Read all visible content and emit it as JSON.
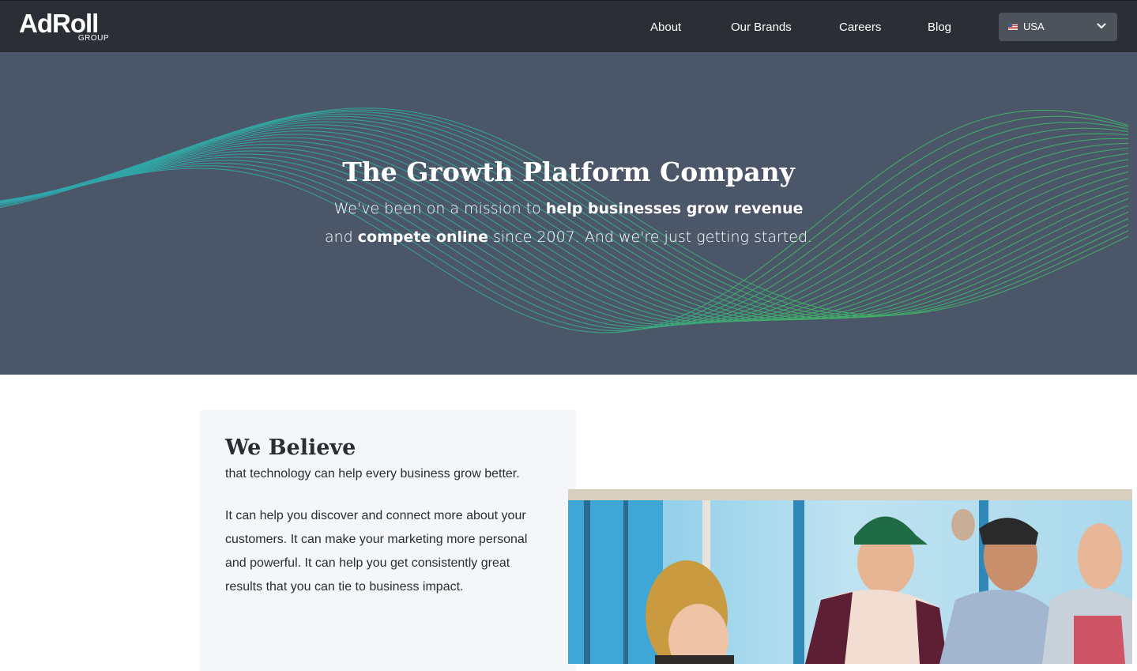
{
  "nav": {
    "logo_main": "AdRoll",
    "logo_sub": "GROUP",
    "links": [
      "About",
      "Our Brands",
      "Careers",
      "Blog"
    ],
    "country": {
      "selected": "USA",
      "flag_icon": "us-flag-icon"
    }
  },
  "hero": {
    "title": "The Growth Platform Company",
    "line1_pre": "We've been on a mission to ",
    "line1_bold": "help businesses grow revenue",
    "line2_pre": "and ",
    "line2_bold": "compete online",
    "line2_post": " since 2007. And we're just getting started."
  },
  "believe": {
    "title": "We Believe",
    "subtitle": "that technology can help every business grow better.",
    "body": "It can help you discover and connect more about your customers. It can make your marketing more personal and powerful. It can help you get consistently great results that you can tie to business impact."
  },
  "colors": {
    "nav_bg": "#2b2f35",
    "hero_bg": "#4b5769",
    "wave_teal": "#2bb3b8",
    "wave_green": "#3fbf6a",
    "card_bg": "#f5f6f9"
  }
}
